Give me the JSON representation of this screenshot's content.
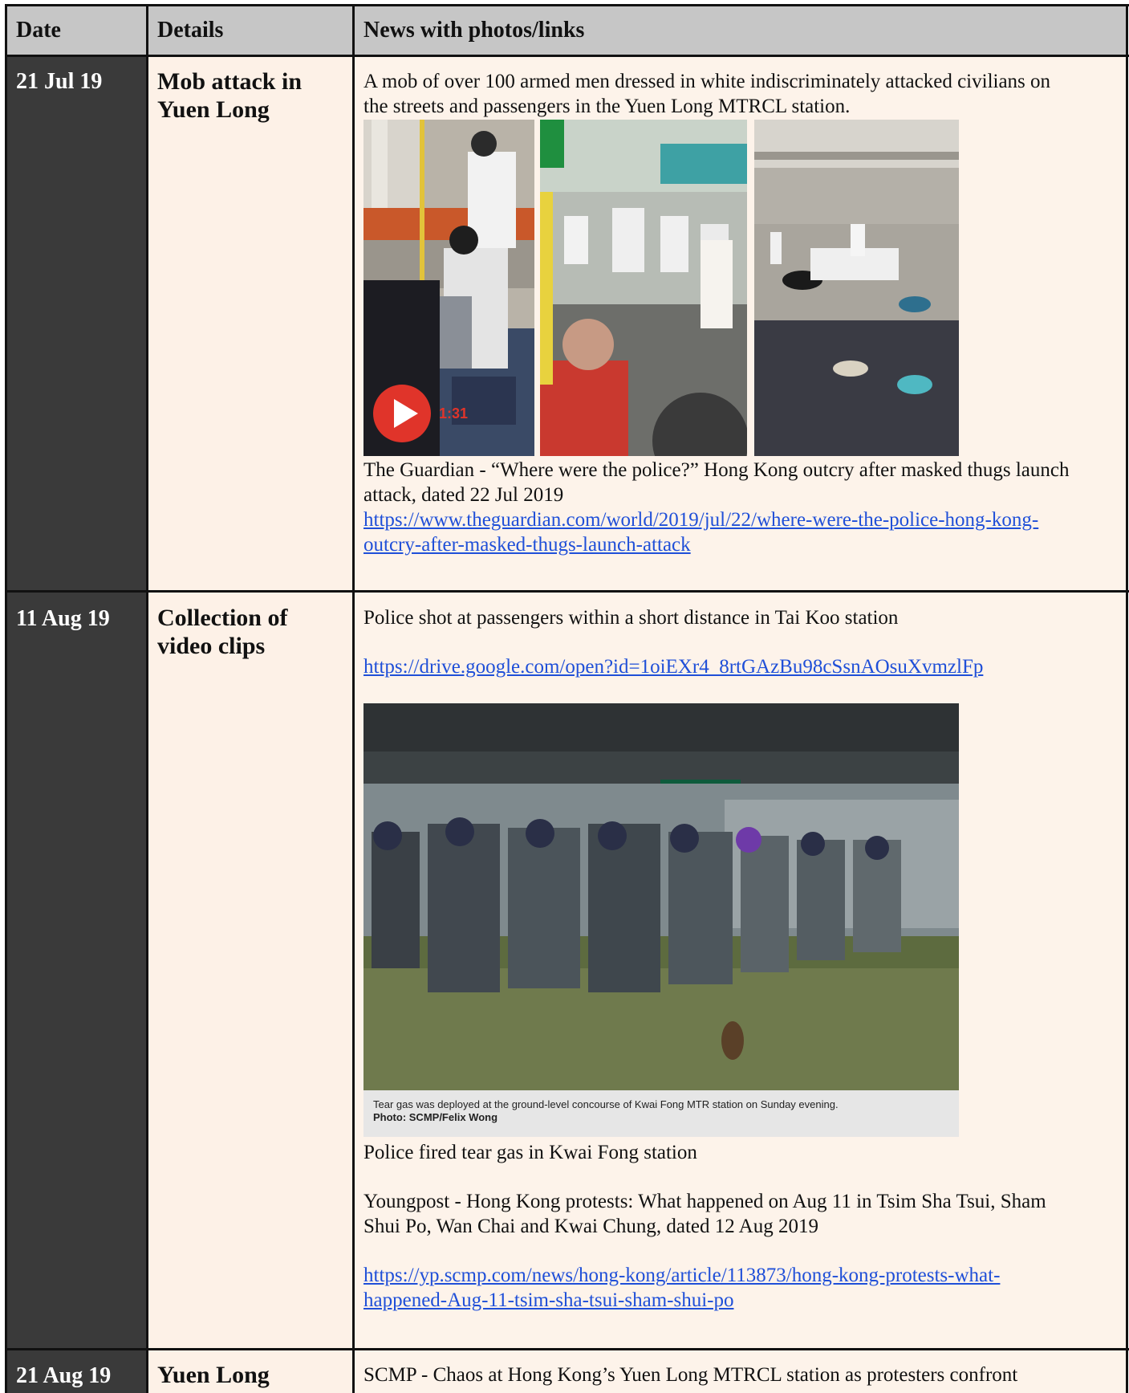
{
  "header": {
    "col_date": "Date",
    "col_details": "Details",
    "col_news": "News with photos/links"
  },
  "rows": [
    {
      "date": "21 Jul 19",
      "details_line1": "Mob attack in",
      "details_line2": "Yuen Long",
      "intro_line1": "A mob of over 100 armed men dressed in white indiscriminately attacked civilians on",
      "intro_line2": "the streets and passengers in the Yuen Long MTRCL station.",
      "video_duration": "1:31",
      "source_line1": "The Guardian - “Where were the police?” Hong Kong outcry after masked thugs launch",
      "source_line2": "attack, dated 22 Jul 2019",
      "link_line1": "https://www.theguardian.com/world/2019/jul/22/where-were-the-police-hong-kong-",
      "link_line2": "outcry-after-masked-thugs-launch-attack"
    },
    {
      "date": "11 Aug 19",
      "details_line1": "Collection of",
      "details_line2": "video clips",
      "intro": "Police shot at passengers within a short distance in Tai Koo station",
      "drive_link": "https://drive.google.com/open?id=1oiEXr4_8rtGAzBu98cSsnAOsuXvmzlFp",
      "photo_caption": "Tear gas was deployed at the ground-level concourse of Kwai Fong MTR station on Sunday evening.",
      "photo_credit": "Photo: SCMP/Felix Wong",
      "photo_desc": "Police fired tear gas in Kwai Fong station",
      "source_line1": "Youngpost - Hong Kong protests: What happened on Aug 11 in Tsim Sha Tsui, Sham",
      "source_line2": "Shui Po, Wan Chai and Kwai Chung, dated 12 Aug 2019",
      "link_line1": "https://yp.scmp.com/news/hong-kong/article/113873/hong-kong-protests-what-",
      "link_line2": "happened-Aug-11-tsim-sha-tsui-sham-shui-po"
    },
    {
      "date": "21 Aug 19",
      "details_line1": "Yuen Long",
      "intro": "SCMP - Chaos at Hong Kong’s Yuen Long MTRCL station as protesters confront"
    }
  ]
}
